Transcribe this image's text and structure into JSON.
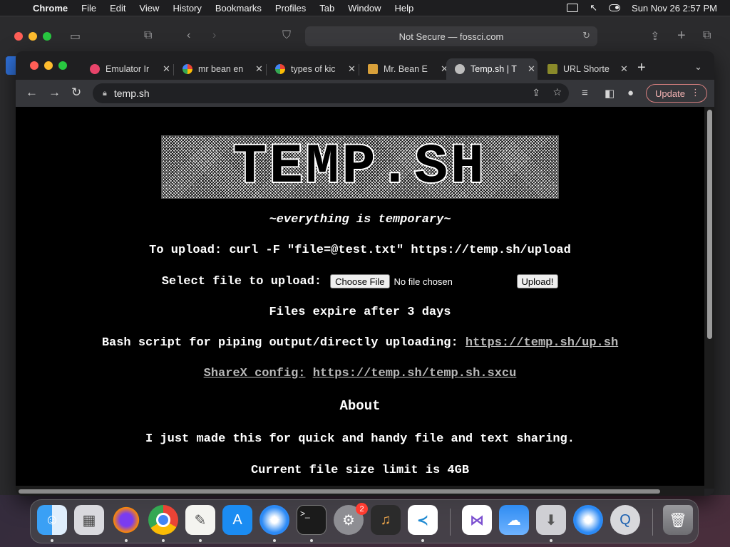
{
  "menubar": {
    "app": "Chrome",
    "items": [
      "File",
      "Edit",
      "View",
      "History",
      "Bookmarks",
      "Profiles",
      "Tab",
      "Window",
      "Help"
    ],
    "datetime": "Sun Nov 26  2:57 PM"
  },
  "safari": {
    "address": "Not Secure — fossci.com"
  },
  "tabs": [
    {
      "title": "Emulator Ir",
      "color": "#e8446a"
    },
    {
      "title": "mr bean en",
      "color": "#ffffff"
    },
    {
      "title": "types of kic",
      "color": "#ffffff"
    },
    {
      "title": "Mr. Bean E",
      "color": "#d8a03a"
    },
    {
      "title": "Temp.sh | T",
      "color": "#bdbdbd",
      "active": true
    },
    {
      "title": "URL Shorte",
      "color": "#8a8a2a"
    }
  ],
  "toolbar": {
    "url": "temp.sh",
    "update_label": "Update"
  },
  "page": {
    "logo_text": "TEMP.SH",
    "tagline": "~everything is temporary~",
    "upload_cmd": "To upload: curl -F \"file=@test.txt\" https://temp.sh/upload",
    "select_label": "Select file to upload:",
    "choose_file": "Choose File",
    "no_file": "No file chosen",
    "upload_button": "Upload!",
    "expire": "Files expire after 3 days",
    "bash_label": "Bash script for piping output/directly uploading:",
    "bash_link": "https://temp.sh/up.sh",
    "sharex_label": "ShareX config:",
    "sharex_link": "https://temp.sh/temp.sh.sxcu",
    "about_heading": "About",
    "about_text": "I just made this for quick and handy file and text sharing.",
    "limit_text": "Current file size limit is 4GB"
  },
  "dock": {
    "items": [
      "finder",
      "launchpad",
      "firefox",
      "chrome",
      "textedit",
      "app-store",
      "safari",
      "terminal",
      "system-settings",
      "garageband",
      "vscode",
      "visual-studio",
      "weather",
      "installer",
      "safari-2",
      "quicktime",
      "trash"
    ],
    "settings_badge": "2"
  }
}
